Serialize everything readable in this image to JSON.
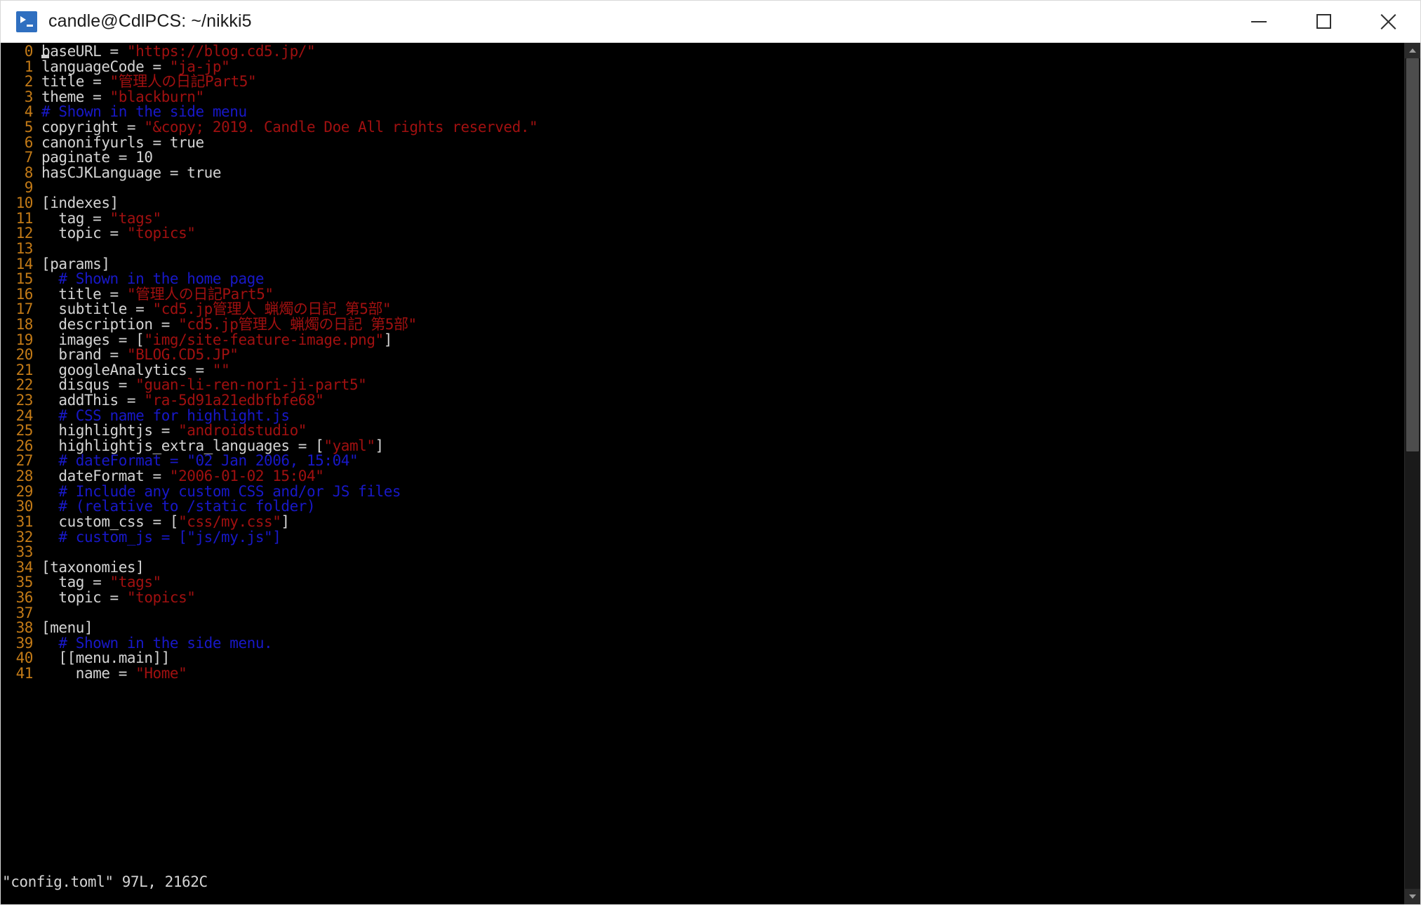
{
  "window": {
    "title": "candle@CdlPCS: ~/nikki5",
    "app_icon": "powershell-icon",
    "controls": {
      "minimize": "minimize-button",
      "maximize": "maximize-button",
      "close": "close-button"
    }
  },
  "colors": {
    "background": "#000000",
    "titlebar": "#ffffff",
    "line_number": "#c47b17",
    "text": "#d4d4d4",
    "string": "#a01010",
    "comment": "#1818c8",
    "scrollbar_thumb": "#4d4d4d"
  },
  "editor": {
    "filename": "config.toml",
    "statusline": "\"config.toml\" 97L, 2162C",
    "lines": [
      {
        "n": "0",
        "tokens": [
          {
            "t": "plain",
            "s": "baseURL = "
          },
          {
            "t": "string",
            "s": "\"https://blog.cd5.jp/\""
          }
        ]
      },
      {
        "n": "1",
        "tokens": [
          {
            "t": "plain",
            "s": "languageCode = "
          },
          {
            "t": "string",
            "s": "\"ja-jp\""
          }
        ]
      },
      {
        "n": "2",
        "tokens": [
          {
            "t": "plain",
            "s": "title = "
          },
          {
            "t": "string",
            "s": "\"管理人の日記Part5\""
          }
        ]
      },
      {
        "n": "3",
        "tokens": [
          {
            "t": "plain",
            "s": "theme = "
          },
          {
            "t": "string",
            "s": "\"blackburn\""
          }
        ]
      },
      {
        "n": "4",
        "tokens": [
          {
            "t": "comment",
            "s": "# Shown in the side menu"
          }
        ]
      },
      {
        "n": "5",
        "tokens": [
          {
            "t": "plain",
            "s": "copyright = "
          },
          {
            "t": "string",
            "s": "\"&copy; 2019. Candle Doe All rights reserved.\""
          }
        ]
      },
      {
        "n": "6",
        "tokens": [
          {
            "t": "plain",
            "s": "canonifyurls = true"
          }
        ]
      },
      {
        "n": "7",
        "tokens": [
          {
            "t": "plain",
            "s": "paginate = 10"
          }
        ]
      },
      {
        "n": "8",
        "tokens": [
          {
            "t": "plain",
            "s": "hasCJKLanguage = true"
          }
        ]
      },
      {
        "n": "9",
        "tokens": []
      },
      {
        "n": "10",
        "tokens": [
          {
            "t": "plain",
            "s": "[indexes]"
          }
        ]
      },
      {
        "n": "11",
        "tokens": [
          {
            "t": "plain",
            "s": "  tag = "
          },
          {
            "t": "string",
            "s": "\"tags\""
          }
        ]
      },
      {
        "n": "12",
        "tokens": [
          {
            "t": "plain",
            "s": "  topic = "
          },
          {
            "t": "string",
            "s": "\"topics\""
          }
        ]
      },
      {
        "n": "13",
        "tokens": []
      },
      {
        "n": "14",
        "tokens": [
          {
            "t": "plain",
            "s": "[params]"
          }
        ]
      },
      {
        "n": "15",
        "tokens": [
          {
            "t": "comment",
            "s": "  # Shown in the home page"
          }
        ]
      },
      {
        "n": "16",
        "tokens": [
          {
            "t": "plain",
            "s": "  title = "
          },
          {
            "t": "string",
            "s": "\"管理人の日記Part5\""
          }
        ]
      },
      {
        "n": "17",
        "tokens": [
          {
            "t": "plain",
            "s": "  subtitle = "
          },
          {
            "t": "string",
            "s": "\"cd5.jp管理人 蝋燭の日記 第5部\""
          }
        ]
      },
      {
        "n": "18",
        "tokens": [
          {
            "t": "plain",
            "s": "  description = "
          },
          {
            "t": "string",
            "s": "\"cd5.jp管理人 蝋燭の日記 第5部\""
          }
        ]
      },
      {
        "n": "19",
        "tokens": [
          {
            "t": "plain",
            "s": "  images = ["
          },
          {
            "t": "string",
            "s": "\"img/site-feature-image.png\""
          },
          {
            "t": "plain",
            "s": "]"
          }
        ]
      },
      {
        "n": "20",
        "tokens": [
          {
            "t": "plain",
            "s": "  brand = "
          },
          {
            "t": "string",
            "s": "\"BLOG.CD5.JP\""
          }
        ]
      },
      {
        "n": "21",
        "tokens": [
          {
            "t": "plain",
            "s": "  googleAnalytics = "
          },
          {
            "t": "string",
            "s": "\"\""
          }
        ]
      },
      {
        "n": "22",
        "tokens": [
          {
            "t": "plain",
            "s": "  disqus = "
          },
          {
            "t": "string",
            "s": "\"guan-li-ren-nori-ji-part5\""
          }
        ]
      },
      {
        "n": "23",
        "tokens": [
          {
            "t": "plain",
            "s": "  addThis = "
          },
          {
            "t": "string",
            "s": "\"ra-5d91a21edbfbfe68\""
          }
        ]
      },
      {
        "n": "24",
        "tokens": [
          {
            "t": "comment",
            "s": "  # CSS name for highlight.js"
          }
        ]
      },
      {
        "n": "25",
        "tokens": [
          {
            "t": "plain",
            "s": "  highlightjs = "
          },
          {
            "t": "string",
            "s": "\"androidstudio\""
          }
        ]
      },
      {
        "n": "26",
        "tokens": [
          {
            "t": "plain",
            "s": "  highlightjs_extra_languages = ["
          },
          {
            "t": "string",
            "s": "\"yaml\""
          },
          {
            "t": "plain",
            "s": "]"
          }
        ]
      },
      {
        "n": "27",
        "tokens": [
          {
            "t": "comment",
            "s": "  # dateFormat = \"02 Jan 2006, 15:04\""
          }
        ]
      },
      {
        "n": "28",
        "tokens": [
          {
            "t": "plain",
            "s": "  dateFormat = "
          },
          {
            "t": "string",
            "s": "\"2006-01-02 15:04\""
          }
        ]
      },
      {
        "n": "29",
        "tokens": [
          {
            "t": "comment",
            "s": "  # Include any custom CSS and/or JS files"
          }
        ]
      },
      {
        "n": "30",
        "tokens": [
          {
            "t": "comment",
            "s": "  # (relative to /static folder)"
          }
        ]
      },
      {
        "n": "31",
        "tokens": [
          {
            "t": "plain",
            "s": "  custom_css = ["
          },
          {
            "t": "string",
            "s": "\"css/my.css\""
          },
          {
            "t": "plain",
            "s": "]"
          }
        ]
      },
      {
        "n": "32",
        "tokens": [
          {
            "t": "comment",
            "s": "  # custom_js = [\"js/my.js\"]"
          }
        ]
      },
      {
        "n": "33",
        "tokens": []
      },
      {
        "n": "34",
        "tokens": [
          {
            "t": "plain",
            "s": "[taxonomies]"
          }
        ]
      },
      {
        "n": "35",
        "tokens": [
          {
            "t": "plain",
            "s": "  tag = "
          },
          {
            "t": "string",
            "s": "\"tags\""
          }
        ]
      },
      {
        "n": "36",
        "tokens": [
          {
            "t": "plain",
            "s": "  topic = "
          },
          {
            "t": "string",
            "s": "\"topics\""
          }
        ]
      },
      {
        "n": "37",
        "tokens": []
      },
      {
        "n": "38",
        "tokens": [
          {
            "t": "plain",
            "s": "[menu]"
          }
        ]
      },
      {
        "n": "39",
        "tokens": [
          {
            "t": "comment",
            "s": "  # Shown in the side menu."
          }
        ]
      },
      {
        "n": "40",
        "tokens": [
          {
            "t": "plain",
            "s": "  [[menu.main]]"
          }
        ]
      },
      {
        "n": "41",
        "tokens": [
          {
            "t": "plain",
            "s": "    name = "
          },
          {
            "t": "string",
            "s": "\"Home\""
          }
        ]
      }
    ]
  },
  "scrollbar": {
    "up_arrow": "scroll-up-arrow-icon",
    "down_arrow": "scroll-down-arrow-icon"
  }
}
